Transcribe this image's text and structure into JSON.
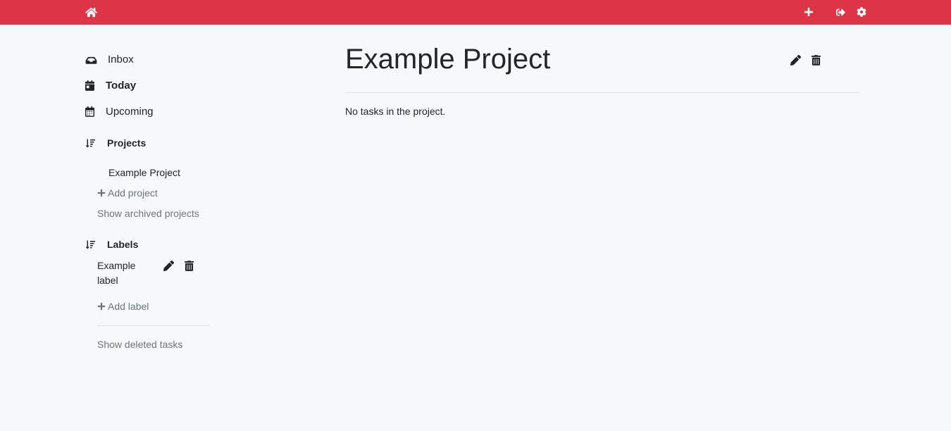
{
  "topbar": {
    "home_icon": "home-icon",
    "add_icon": "plus-icon",
    "logout_icon": "sign-out-icon",
    "settings_icon": "gear-icon",
    "bg_color": "#dc3545"
  },
  "sidebar": {
    "nav": [
      {
        "label": "Inbox",
        "icon": "inbox-icon"
      },
      {
        "label": "Today",
        "icon": "calendar-day-icon"
      },
      {
        "label": "Upcoming",
        "icon": "calendar-icon"
      }
    ],
    "projects": {
      "heading": "Projects",
      "icon": "sort-icon",
      "items": [
        {
          "label": "Example Project"
        }
      ],
      "add_label": "Add project",
      "archived_label": "Show archived projects"
    },
    "labels": {
      "heading": "Labels",
      "icon": "sort-icon",
      "items": [
        {
          "label_line1": "Example",
          "label_line2": "label"
        }
      ],
      "add_label": "Add label"
    },
    "deleted_label": "Show deleted tasks"
  },
  "main": {
    "title": "Example Project",
    "empty_message": "No tasks in the project."
  }
}
